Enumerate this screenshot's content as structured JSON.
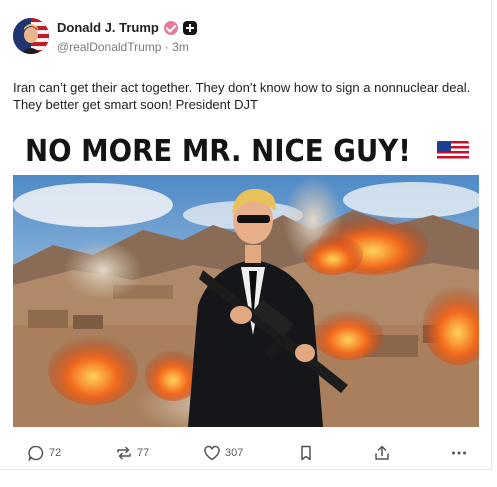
{
  "post": {
    "author_name": "Donald J. Trump",
    "handle": "@realDonaldTrump",
    "separator": "·",
    "time": "3m",
    "text": "Iran can’t get their act together. They don’t know how to sign a nonnuclear deal. They better get smart soon! President DJT",
    "image_headline": "NO MORE MR. NICE GUY!",
    "headline_emoji": "us-flag-icon"
  },
  "actions": {
    "replies": "72",
    "reposts": "77",
    "likes": "307"
  },
  "colors": {
    "verified_badge": "#e27b9c",
    "text": "#1f1f1f",
    "muted": "#7a7a7a"
  }
}
